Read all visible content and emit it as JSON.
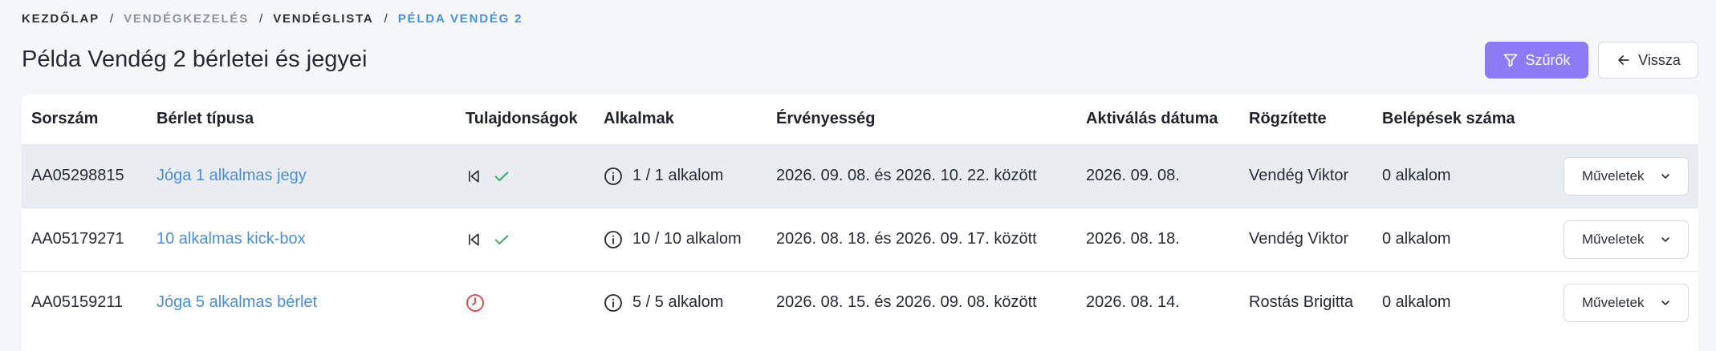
{
  "breadcrumb": [
    "KEZDŐLAP",
    "VENDÉGKEZELÉS",
    "VENDÉGLISTA",
    "PÉLDA VENDÉG 2"
  ],
  "title": "Példa Vendég 2 bérletei és jegyei",
  "buttons": {
    "filter": "Szűrők",
    "back": "Vissza"
  },
  "table": {
    "headers": [
      "Sorszám",
      "Bérlet típusa",
      "Tulajdonságok",
      "Alkalmak",
      "Érvényesség",
      "Aktiválás dátuma",
      "Rögzítette",
      "Belépések száma"
    ],
    "rows": [
      {
        "id": "AA05298815",
        "type": "Jóga 1 alkalmas jegy",
        "props": [
          "skip-back-icon",
          "check-icon"
        ],
        "usage": "1 / 1 alkalom",
        "validity": "2026. 09. 08. és 2026. 10. 22. között",
        "activation": "2026. 09. 08.",
        "recorded_by": "Vendég Viktor",
        "entries": "0 alkalom",
        "action": "Műveletek"
      },
      {
        "id": "AA05179271",
        "type": "10 alkalmas kick-box",
        "props": [
          "skip-back-icon",
          "check-icon"
        ],
        "usage": "10 / 10 alkalom",
        "validity": "2026. 08. 18. és 2026. 09. 17. között",
        "activation": "2026. 08. 18.",
        "recorded_by": "Vendég Viktor",
        "entries": "0 alkalom",
        "action": "Műveletek"
      },
      {
        "id": "AA05159211",
        "type": "Jóga 5 alkalmas bérlet",
        "props": [
          "clock-icon"
        ],
        "usage": "5 / 5 alkalom",
        "validity": "2026. 08. 15. és 2026. 09. 08. között",
        "activation": "2026. 08. 14.",
        "recorded_by": "Rostás Brigitta",
        "entries": "0 alkalom",
        "action": "Műveletek"
      }
    ]
  },
  "colors": {
    "accent": "#8b7cf6",
    "link": "#4a8fd6",
    "check": "#3fa86b",
    "clock": "#d64545",
    "row_highlight": "#e9ecf1"
  }
}
